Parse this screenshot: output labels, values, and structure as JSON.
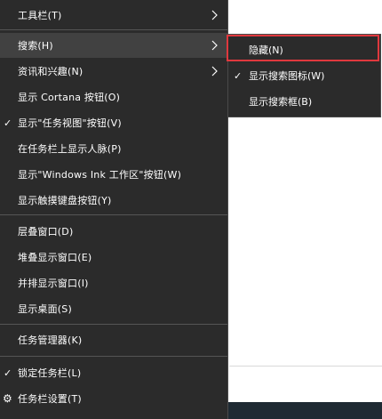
{
  "menu": {
    "items": [
      {
        "label": "工具栏(T)",
        "submenu": true,
        "check": false
      },
      {
        "label": "搜索(H)",
        "submenu": true,
        "check": false,
        "active": true
      },
      {
        "label": "资讯和兴趣(N)",
        "submenu": true,
        "check": false
      },
      {
        "label": "显示 Cortana 按钮(O)",
        "submenu": false,
        "check": false
      },
      {
        "label": "显示\"任务视图\"按钮(V)",
        "submenu": false,
        "check": true
      },
      {
        "label": "在任务栏上显示人脉(P)",
        "submenu": false,
        "check": false
      },
      {
        "label": "显示\"Windows Ink 工作区\"按钮(W)",
        "submenu": false,
        "check": false
      },
      {
        "label": "显示触摸键盘按钮(Y)",
        "submenu": false,
        "check": false
      },
      {
        "label": "层叠窗口(D)",
        "submenu": false,
        "check": false
      },
      {
        "label": "堆叠显示窗口(E)",
        "submenu": false,
        "check": false
      },
      {
        "label": "并排显示窗口(I)",
        "submenu": false,
        "check": false
      },
      {
        "label": "显示桌面(S)",
        "submenu": false,
        "check": false
      },
      {
        "label": "任务管理器(K)",
        "submenu": false,
        "check": false
      },
      {
        "label": "锁定任务栏(L)",
        "submenu": false,
        "check": true
      },
      {
        "label": "任务栏设置(T)",
        "submenu": false,
        "check": false,
        "icon": "gear-icon"
      }
    ]
  },
  "search_submenu": {
    "items": [
      {
        "label": "隐藏(N)",
        "check": false,
        "highlighted": true
      },
      {
        "label": "显示搜索图标(W)",
        "check": true
      },
      {
        "label": "显示搜索框(B)",
        "check": false
      }
    ]
  },
  "glyphs": {
    "check": "✓",
    "gear": "⚙"
  },
  "colors": {
    "menu_bg": "#2b2b2b",
    "hover_bg": "#414141",
    "focus_border": "#e0383e",
    "taskbar": "#1f2a33"
  }
}
